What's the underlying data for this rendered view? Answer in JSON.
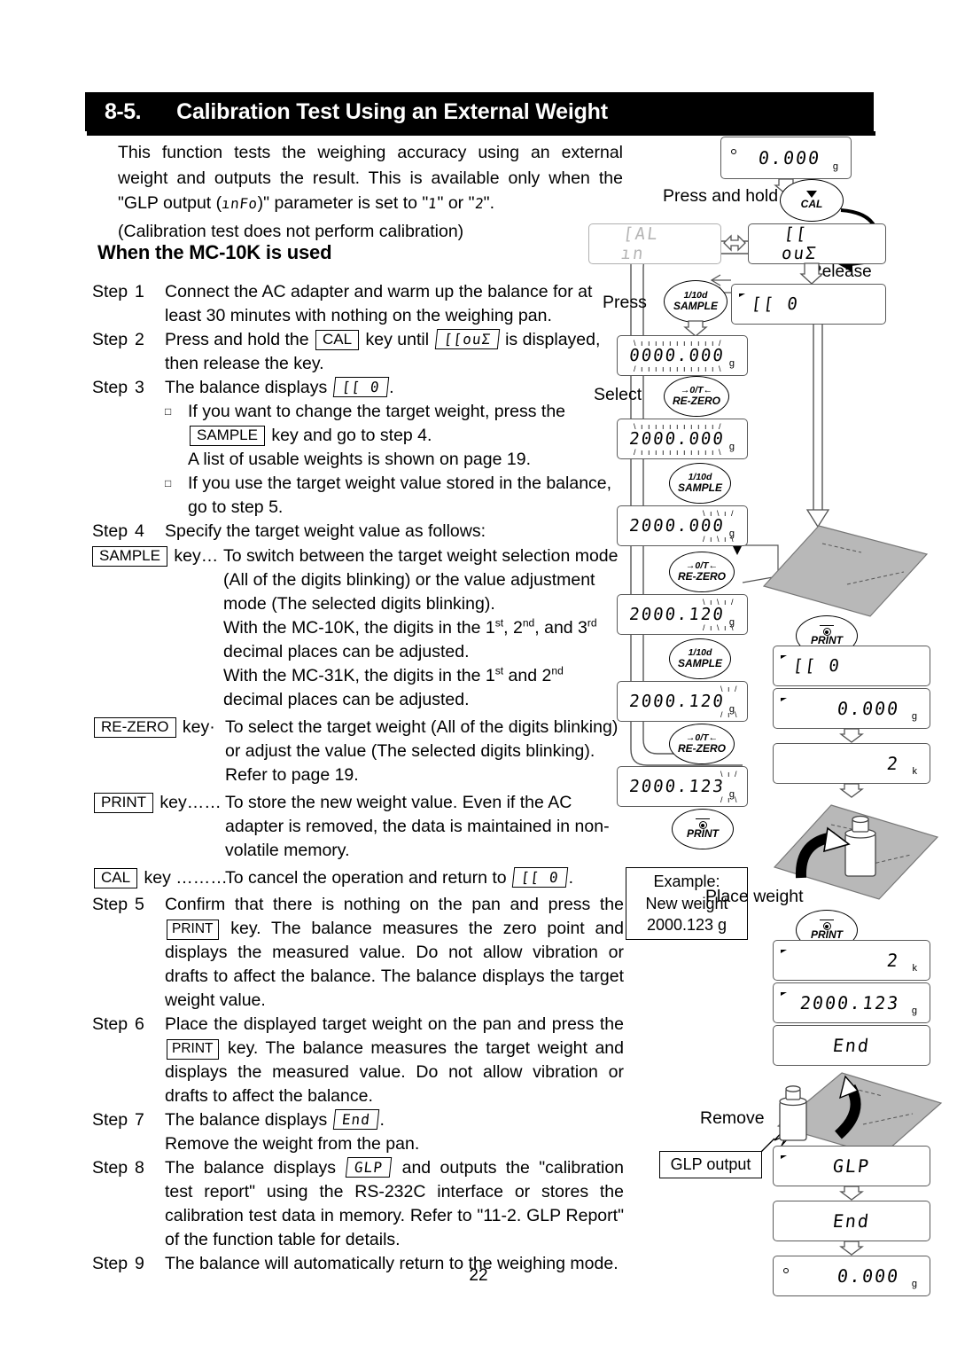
{
  "header": {
    "section_number": "8-5.",
    "title": "Calibration Test Using an External Weight"
  },
  "intro": {
    "line": "This function tests the weighing accuracy using an external weight and outputs the result. This is available only when the \"GLP output (",
    "param_lcd": "ınFo",
    "line2": ")\" parameter is set to \"",
    "val1_lcd": "1",
    "or": "\" or \"",
    "val2_lcd": "2",
    "line3": "\".",
    "line4": "(Calibration test does not perform calibration)"
  },
  "subhead": "When the MC-10K is used",
  "steps": {
    "word": "Step",
    "items": [
      {
        "num": "1",
        "text": "Connect the AC adapter and warm up the balance for at least 30 minutes with nothing on the weighing pan."
      },
      {
        "num": "2",
        "pre": "Press and hold the",
        "key": "CAL",
        "mid": "key until",
        "lcd": "[[ouƩ",
        "post": "is displayed, then release the key."
      },
      {
        "num": "3",
        "pre": "The balance displays",
        "lcd": "[[   0",
        "post": "."
      },
      {
        "num": "4",
        "text": "Specify the target weight value as follows:"
      },
      {
        "num": "5",
        "pre": "Confirm that there is nothing on the pan and press the",
        "key": "PRINT",
        "post": "key. The balance measures the zero point and displays the measured value. Do not allow vibration or drafts to affect the balance. The balance displays the target weight value."
      },
      {
        "num": "6",
        "pre": "Place the displayed target weight on the pan and press the",
        "key": "PRINT",
        "post": "key. The balance measures the target weight and displays the measured value. Do not allow vibration or drafts to affect the balance."
      },
      {
        "num": "7",
        "pre": "The balance displays",
        "lcd": "End",
        "post": ".",
        "extra": "Remove the weight from the pan."
      },
      {
        "num": "8",
        "pre": "The balance displays",
        "lcd": "GLP",
        "post": "and outputs the \"calibration test report\" using the RS-232C interface or stores the calibration test data in memory. Refer to \"11-2. GLP Report\" of the function table for details."
      },
      {
        "num": "9",
        "text": "The balance will automatically return to the weighing mode."
      }
    ],
    "bullets_step3": [
      {
        "pre": "If you want to change the target weight, press the",
        "key": "SAMPLE",
        "post": "key and go to step 4.",
        "extra": "A list of usable weights is shown on page 19."
      },
      {
        "pre": "If you use the target weight value stored in the balance, go to step 5.",
        "key": "",
        "post": ""
      }
    ],
    "keydefs": [
      {
        "key": "SAMPLE",
        "word": "key",
        "dots": "…",
        "body": "To switch between the target weight selection mode (All of the digits blinking) or the value adjustment mode (The selected digits blinking).",
        "body2a": "With the MC-10K, the digits in the 1",
        "sup1": "st",
        "body2b": ", 2",
        "sup2": "nd",
        "body2c": ", and 3",
        "sup3": "rd",
        "body2d": " decimal places can be adjusted.",
        "body3a": "With the MC-31K, the digits in the 1",
        "sup4": "st",
        "body3b": " and 2",
        "sup5": "nd",
        "body3c": " decimal places can be adjusted."
      },
      {
        "key": "RE-ZERO",
        "word": "key",
        "dots": "·",
        "body": "To select the target weight (All of the digits blinking) or adjust the value (The selected digits blinking). Refer to page 19."
      },
      {
        "key": "PRINT",
        "word": "key",
        "dots": "……",
        "body": "To store the new weight value. Even if the AC adapter is removed, the data is maintained in non-volatile memory."
      },
      {
        "key": "CAL",
        "word": "key",
        "dots": "………",
        "body": "To cancel the operation and return to",
        "lcd": "[[   0",
        "body_end": "."
      }
    ]
  },
  "page_number": "22",
  "flowchart": {
    "labels": {
      "press_and_hold": "Press and hold",
      "release": "Release",
      "press": "Press",
      "select": "Select",
      "place_weight": "Place weight",
      "remove": "Remove",
      "glp_output": "GLP output"
    },
    "example_box": {
      "l1": "Example:",
      "l2": "New weight",
      "l3": "2000.123 g"
    },
    "keys": {
      "cal": {
        "l1": "",
        "l2": "CAL"
      },
      "sample": {
        "l1": "1/10d",
        "l2": "SAMPLE"
      },
      "rezero": {
        "l1": "→0/T←",
        "l2": "RE-ZERO"
      },
      "print": {
        "l1": "",
        "l2": "PRINT"
      }
    },
    "displays": [
      {
        "id": "d1",
        "value": "0.000",
        "unit": "g",
        "indicator": "circle"
      },
      {
        "id": "d2",
        "value": "[AL  ın",
        "unit": "",
        "indicator": "none",
        "style": "grey"
      },
      {
        "id": "d3",
        "value": "[[  ouƩ",
        "unit": "",
        "indicator": "none"
      },
      {
        "id": "d4",
        "value": "[[      0",
        "unit": "",
        "indicator": "triangle"
      },
      {
        "id": "d5",
        "value": "0000.000",
        "unit": "g",
        "indicator": "none",
        "blink": "all"
      },
      {
        "id": "d6",
        "value": "2000.000",
        "unit": "g",
        "indicator": "none",
        "blink": "all"
      },
      {
        "id": "d7",
        "value": "2000.000",
        "unit": "g",
        "indicator": "none",
        "blink": "last3"
      },
      {
        "id": "d8",
        "value": "2000.120",
        "unit": "g",
        "indicator": "none",
        "blink": "last3"
      },
      {
        "id": "d9",
        "value": "2000.120",
        "unit": "g",
        "indicator": "none",
        "blink": "last1"
      },
      {
        "id": "d10",
        "value": "2000.123",
        "unit": "g",
        "indicator": "none",
        "blink": "last1"
      },
      {
        "id": "d11",
        "value": "[[      0",
        "unit": "",
        "indicator": "triangle"
      },
      {
        "id": "d12",
        "value": "0.000",
        "unit": "g",
        "indicator": "triangle"
      },
      {
        "id": "d13",
        "value": "2",
        "unit": "k",
        "indicator": "none"
      },
      {
        "id": "d14",
        "value": "2",
        "unit": "k",
        "indicator": "triangle"
      },
      {
        "id": "d15",
        "value": "2000.123",
        "unit": "g",
        "indicator": "triangle"
      },
      {
        "id": "d16",
        "value": "End",
        "unit": "",
        "indicator": "none"
      },
      {
        "id": "d17",
        "value": "GLP",
        "unit": "",
        "indicator": "triangle"
      },
      {
        "id": "d18",
        "value": "End",
        "unit": "",
        "indicator": "none"
      },
      {
        "id": "d19",
        "value": "0.000",
        "unit": "g",
        "indicator": "circle"
      }
    ]
  }
}
